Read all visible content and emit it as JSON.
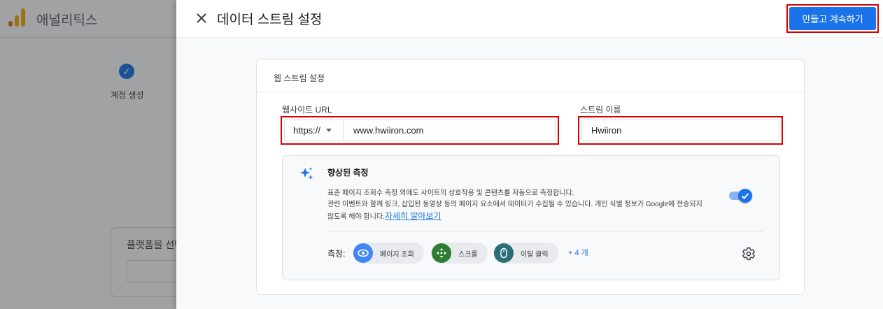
{
  "background_app": {
    "title": "애널리틱스",
    "step_label": "계정 생성",
    "step_check": "✓",
    "card_title": "플랫폼을 선택",
    "colors": {
      "logo_orange": "#f9ab00",
      "logo_dark": "#e37400"
    }
  },
  "panel": {
    "title": "데이터 스트림 설정",
    "primary_button_label": "만들고 계속하기",
    "card": {
      "title": "웹 스트림 설정",
      "website_url_label": "웹사이트 URL",
      "protocol_value": "https://",
      "url_value": "www.hwiiron.com",
      "stream_name_label": "스트림 이름",
      "stream_name_value": "Hwiiron",
      "enhanced_measurement": {
        "title": "향상된 측정",
        "description_line1": "표준 페이지 조회수 측정 외에도 사이트의 상호작용 및 콘텐츠를 자동으로 측정합니다.",
        "description_line2": "관련 이벤트와 함께 링크, 삽입된 동영상 등의 페이지 요소에서 데이터가 수집될 수 있습니다. 개인 식별 정보가 Google에 전송되지",
        "description_line3": "않도록 해야 합니다.",
        "learn_more_link": "자세히 알아보기",
        "enabled": true,
        "measurements_label": "측정:",
        "chips": [
          {
            "label": "페이지 조회",
            "icon": "eye-icon",
            "color": "#4285f4"
          },
          {
            "label": "스크롤",
            "icon": "scroll-icon",
            "color": "#2e7d32"
          },
          {
            "label": "이탈 클릭",
            "icon": "mouse-icon",
            "color": "#2b6e77"
          }
        ],
        "more_label": "+ 4 개"
      }
    }
  },
  "colors": {
    "accent": "#1a73e8",
    "highlight": "#d50000"
  }
}
